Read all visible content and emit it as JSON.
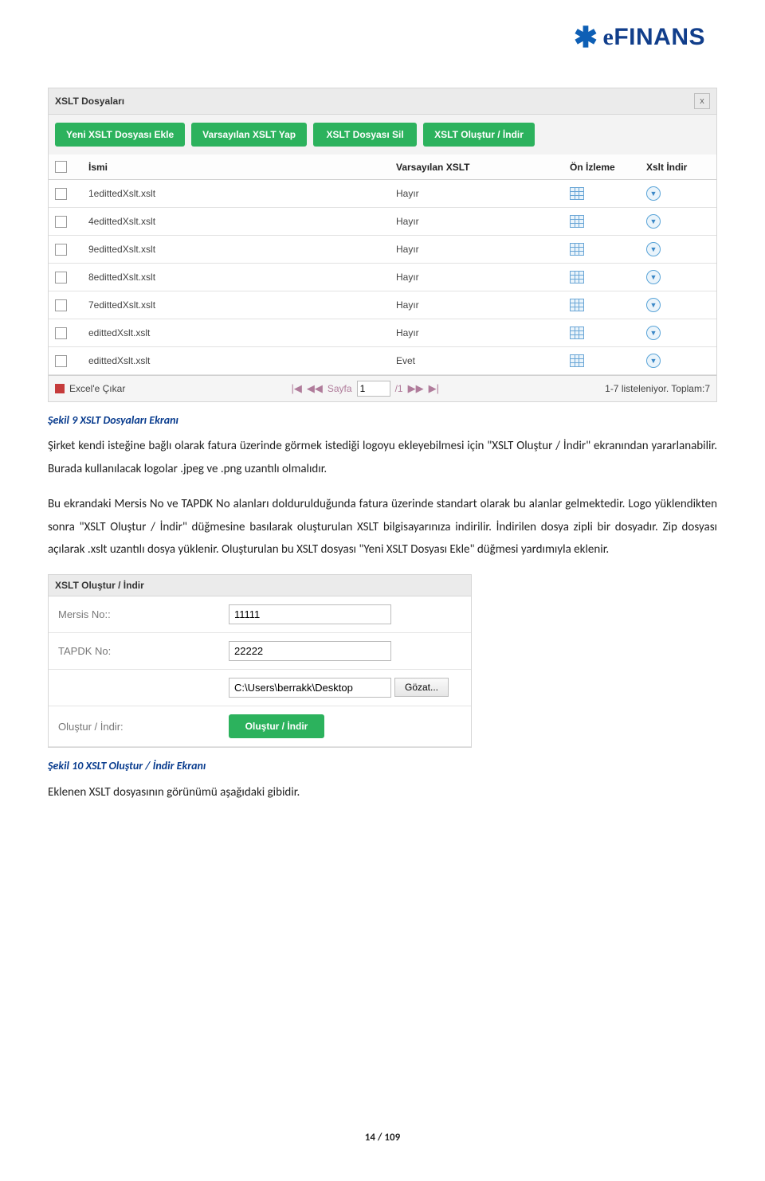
{
  "logo": {
    "star": "✱",
    "e": "e",
    "finans": "FINANS"
  },
  "grid_panel": {
    "title": "XSLT Dosyaları",
    "close": "x",
    "buttons": [
      "Yeni XSLT Dosyası Ekle",
      "Varsayılan XSLT Yap",
      "XSLT Dosyası Sil",
      "XSLT Oluştur / İndir"
    ],
    "headers": {
      "name": "İsmi",
      "default": "Varsayılan XSLT",
      "preview": "Ön İzleme",
      "download": "Xslt İndir"
    },
    "rows": [
      {
        "name": "1edittedXslt.xslt",
        "default": "Hayır"
      },
      {
        "name": "4edittedXslt.xslt",
        "default": "Hayır"
      },
      {
        "name": "9edittedXslt.xslt",
        "default": "Hayır"
      },
      {
        "name": "8edittedXslt.xslt",
        "default": "Hayır"
      },
      {
        "name": "7edittedXslt.xslt",
        "default": "Hayır"
      },
      {
        "name": "edittedXslt.xslt",
        "default": "Hayır"
      },
      {
        "name": "edittedXslt.xslt",
        "default": "Evet"
      }
    ],
    "footer": {
      "excel": "Excel'e Çıkar",
      "page_label": "Sayfa",
      "page_value": "1",
      "page_total": "/1",
      "listing": "1-7 listeleniyor. Toplam:7"
    }
  },
  "caption1": "Şekil 9 XSLT Dosyaları Ekranı",
  "para1": "Şirket kendi isteğine bağlı olarak fatura üzerinde görmek istediği logoyu ekleyebilmesi için \"XSLT Oluştur / İndir\" ekranından yararlanabilir. Burada kullanılacak logolar .jpeg ve .png uzantılı olmalıdır.",
  "para2": "Bu ekrandaki Mersis No ve TAPDK No alanları doldurulduğunda fatura üzerinde standart olarak bu alanlar gelmektedir. Logo yüklendikten sonra \"XSLT Oluştur / İndir\" düğmesine basılarak oluşturulan XSLT bilgisayarınıza indirilir. İndirilen dosya zipli bir dosyadır. Zip dosyası açılarak .xslt uzantılı dosya yüklenir. Oluşturulan bu XSLT dosyası \"Yeni XSLT Dosyası Ekle\" düğmesi yardımıyla eklenir.",
  "form_panel": {
    "title": "XSLT Oluştur / İndir",
    "rows": {
      "mersis_label": "Mersis No::",
      "mersis_value": "11111",
      "tapdk_label": "TAPDK No:",
      "tapdk_value": "22222",
      "file_value": "C:\\Users\\berrakk\\Desktop",
      "browse": "Gözat...",
      "action_label": "Oluştur / İndir:",
      "action_btn": "Oluştur / İndir"
    }
  },
  "caption2": "Şekil 10 XSLT Oluştur / İndir Ekranı",
  "para3": "Eklenen XSLT dosyasının görünümü aşağıdaki gibidir.",
  "page_num": "14 / 109"
}
